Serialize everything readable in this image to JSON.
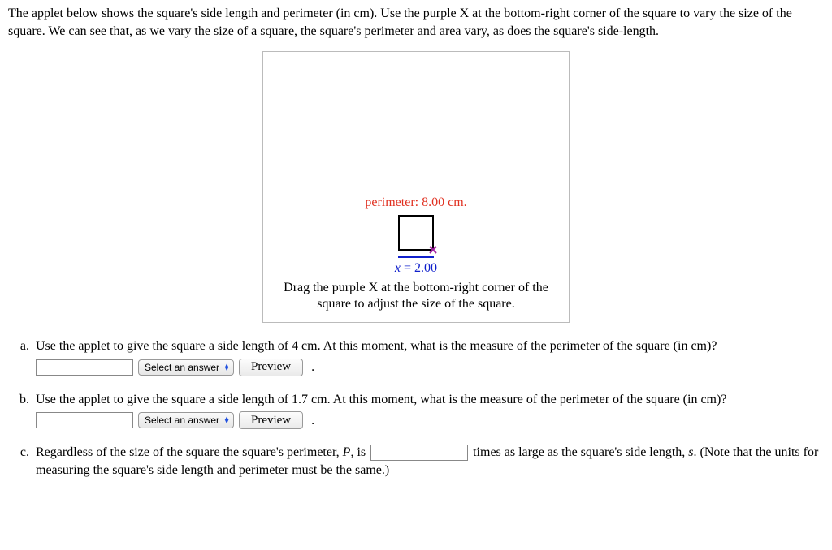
{
  "intro": "The applet below shows the square's side length and perimeter (in cm). Use the purple X at the bottom-right corner of the square to vary the size of the square. We can see that, as we vary the size of a square, the square's perimeter and area vary, as does the square's side-length.",
  "applet": {
    "perimeter_label": "perimeter: 8.00 cm.",
    "x_var": "x",
    "x_eq": " = 2.00",
    "instructions": "Drag the purple X at the bottom-right corner of the square to adjust the size of the square."
  },
  "select_placeholder": "Select an answer",
  "preview_label": "Preview",
  "questions": {
    "a": {
      "marker": "a.",
      "prompt": "Use the applet to give the square a side length of 4 cm. At this moment, what is the measure of the perimeter of the square (in cm)?"
    },
    "b": {
      "marker": "b.",
      "prompt": "Use the applet to give the square a side length of 1.7 cm. At this moment, what is the measure of the perimeter of the square (in cm)?"
    },
    "c": {
      "marker": "c.",
      "pre": "Regardless of the size of the square the square's perimeter, ",
      "P": "P",
      "between": ", is ",
      "after": " times as large as the square's side length, ",
      "s": "s",
      "tail": ". (Note that the units for measuring the square's side length and perimeter must be the same.)"
    }
  },
  "dot": "."
}
